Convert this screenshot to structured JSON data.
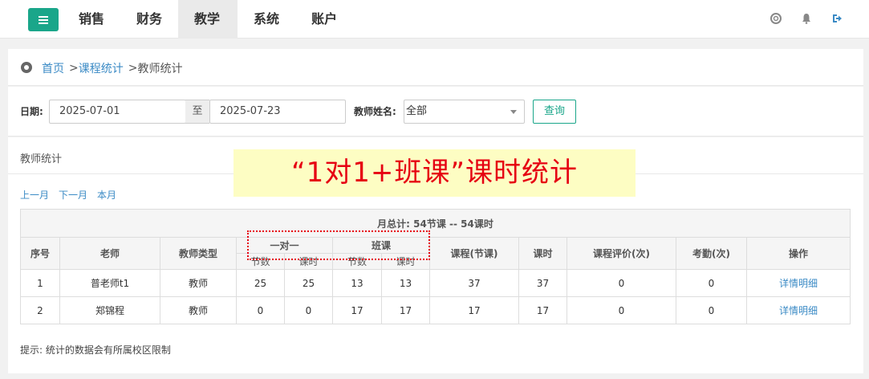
{
  "nav": {
    "items": [
      {
        "label": "销售",
        "active": false
      },
      {
        "label": "财务",
        "active": false
      },
      {
        "label": "教学",
        "active": true
      },
      {
        "label": "系统",
        "active": false
      },
      {
        "label": "账户",
        "active": false
      }
    ],
    "accent": "#1aa68a",
    "top_icons": [
      "lifebuoy-icon",
      "bell-icon",
      "logout-icon"
    ]
  },
  "breadcrumb": {
    "home": "首页",
    "sep1": ">",
    "course": "课程统计",
    "sep2": ">",
    "current": "教师统计"
  },
  "filter": {
    "date_label": "日期:",
    "date_from": "2025-07-01",
    "to_label": "至",
    "date_to": "2025-07-23",
    "teacher_label": "教师姓名:",
    "teacher_value": "全部",
    "query_label": "查询"
  },
  "stats": {
    "title": "教师统计",
    "overlay_text": "“1对1+班课”课时统计",
    "links": {
      "prev": "上一月",
      "next": "下一月",
      "current": "本月"
    },
    "total_label": "月总计:",
    "total_value": "54节课 -- 54课时",
    "headers": {
      "index": "序号",
      "teacher": "老师",
      "type": "教师类型",
      "one_on_one": "一对一",
      "class": "班课",
      "sections": "节数",
      "hours": "课时",
      "course_sections": "课程(节课)",
      "course_hours": "课时",
      "evaluation": "课程评价(次)",
      "attendance": "考勤(次)",
      "action": "操作"
    },
    "rows": [
      {
        "index": "1",
        "teacher": "普老师t1",
        "type": "教师",
        "o_sections": "25",
        "o_hours": "25",
        "c_sections": "13",
        "c_hours": "13",
        "course_sections": "37",
        "course_hours": "37",
        "evaluation": "0",
        "attendance": "0",
        "action": "详情明细"
      },
      {
        "index": "2",
        "teacher": "郑锦程",
        "type": "教师",
        "o_sections": "0",
        "o_hours": "0",
        "c_sections": "17",
        "c_hours": "17",
        "course_sections": "17",
        "course_hours": "17",
        "evaluation": "0",
        "attendance": "0",
        "action": "详情明细"
      }
    ],
    "tip": "提示: 统计的数据会有所属校区限制"
  }
}
